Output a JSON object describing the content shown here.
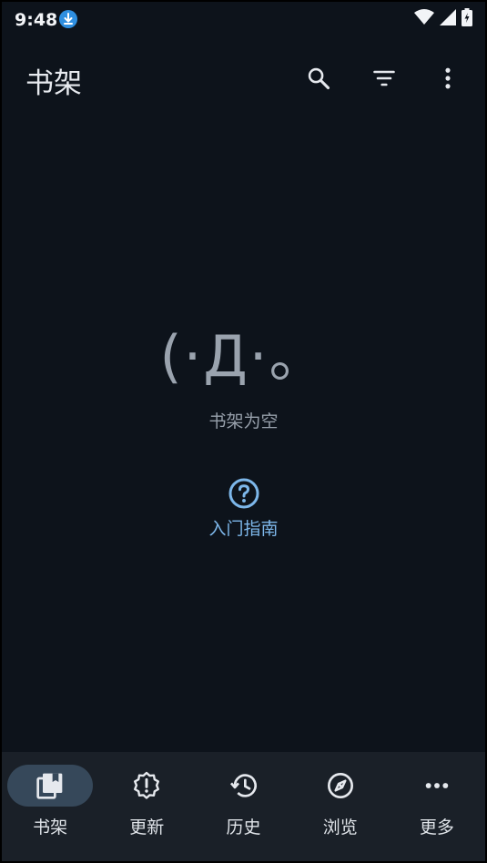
{
  "status_bar": {
    "time": "9:48",
    "icons": [
      "download-notification-icon",
      "wifi-icon",
      "signal-icon",
      "battery-charging-icon"
    ]
  },
  "app_bar": {
    "title": "书架",
    "actions": [
      "search-icon",
      "filter-icon",
      "more-vert-icon"
    ]
  },
  "empty_state": {
    "face": "(·Д·。",
    "message": "书架为空"
  },
  "guide": {
    "icon": "help-circle-icon",
    "label": "入门指南"
  },
  "bottom_nav": {
    "items": [
      {
        "label": "书架",
        "icon": "library-icon",
        "active": true
      },
      {
        "label": "更新",
        "icon": "new-releases-icon",
        "active": false
      },
      {
        "label": "历史",
        "icon": "history-icon",
        "active": false
      },
      {
        "label": "浏览",
        "icon": "explore-icon",
        "active": false
      },
      {
        "label": "更多",
        "icon": "more-horiz-icon",
        "active": false
      }
    ]
  },
  "colors": {
    "background": "#0d131b",
    "bottom_nav": "#1a2028",
    "active_pill": "#36485a",
    "accent": "#7db7ea",
    "download_badge": "#2f8fe0"
  }
}
